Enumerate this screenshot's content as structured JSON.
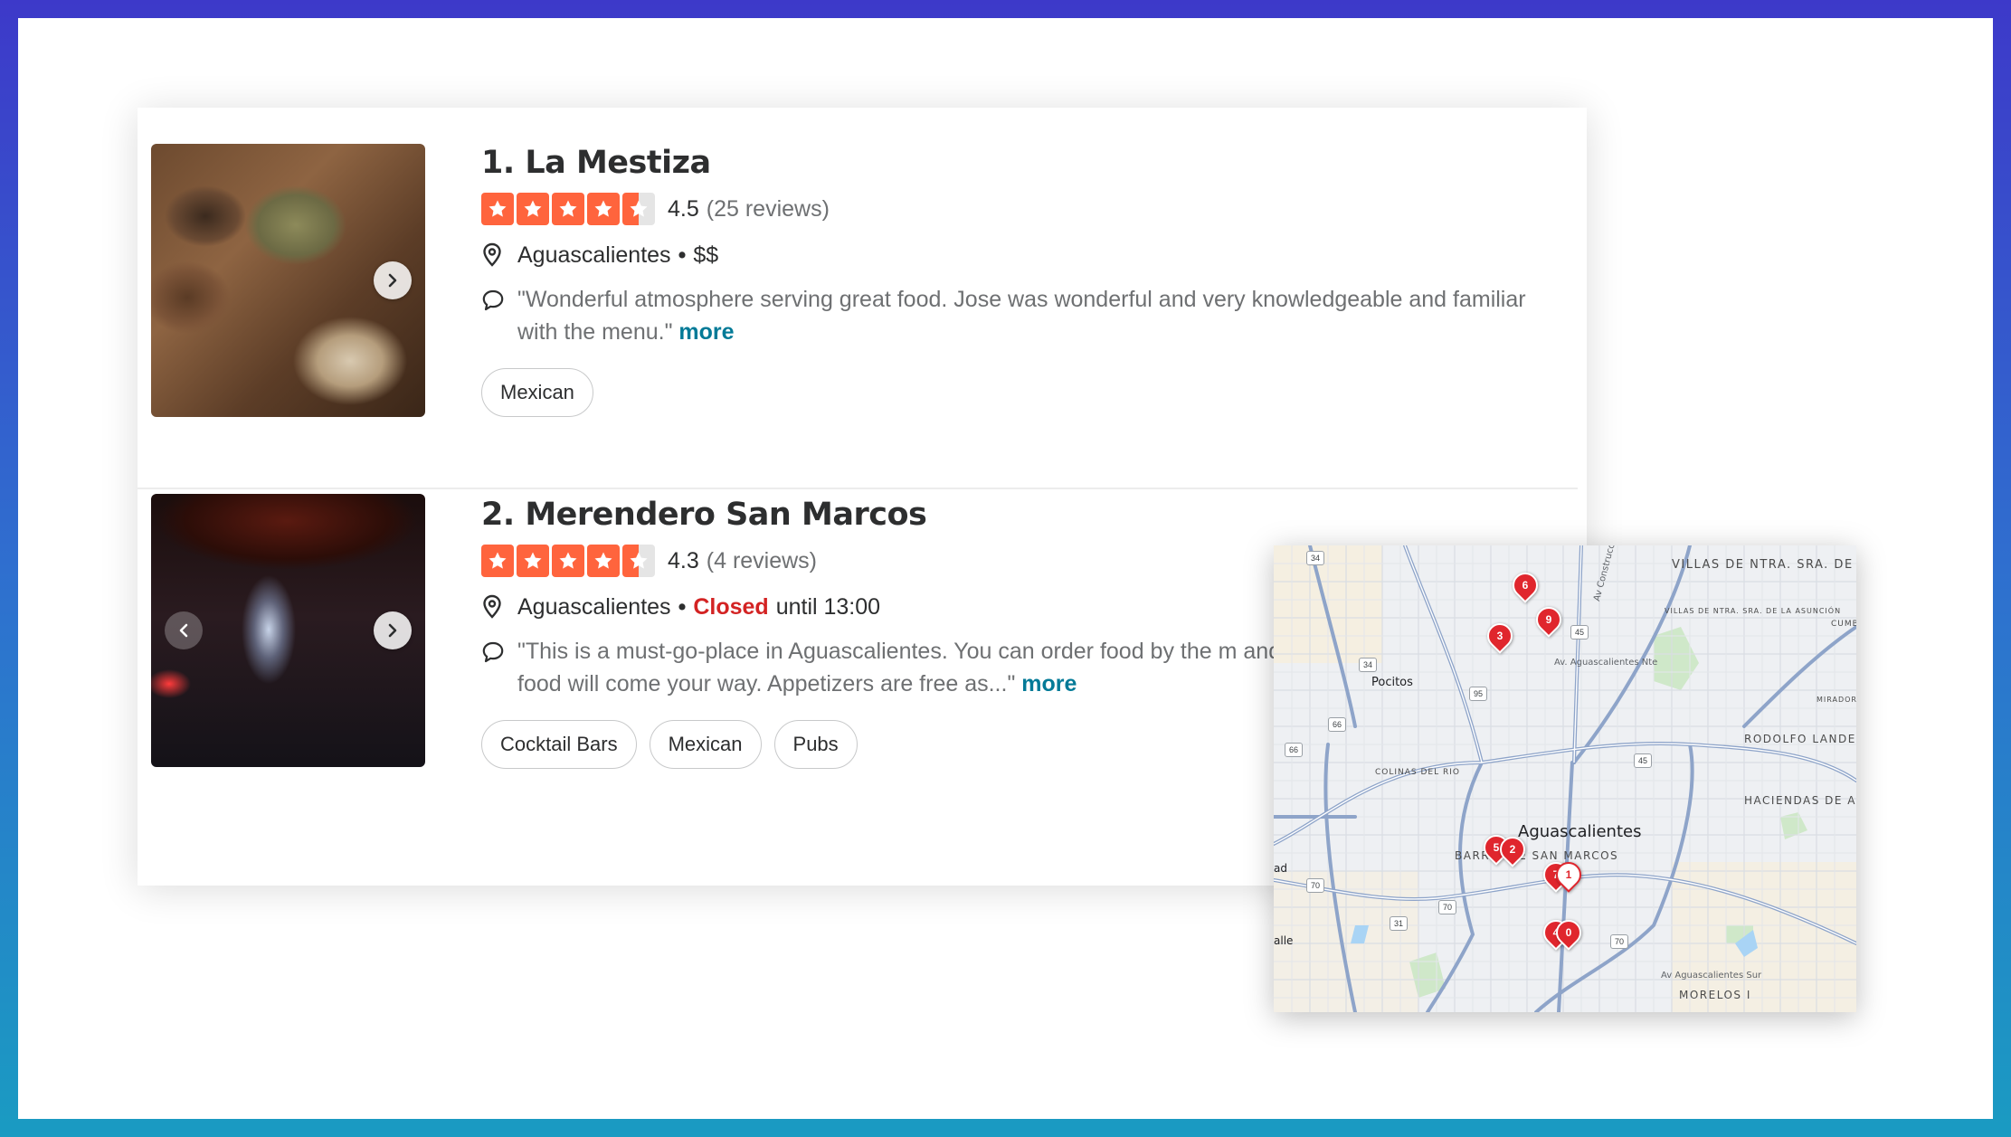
{
  "listings": [
    {
      "title": "1. La Mestiza",
      "rating": "4.5",
      "stars_value": 4.5,
      "reviews": "(25 reviews)",
      "location": "Aguascalientes",
      "separator": "•",
      "price": "$$",
      "quote": "\"Wonderful atmosphere serving great food. Jose was wonderful and very knowledgeable and familiar with the menu.\"",
      "more": "more",
      "tags": [
        "Mexican"
      ]
    },
    {
      "title": "2. Merendero San Marcos",
      "rating": "4.3",
      "stars_value": 4.3,
      "reviews": "(4 reviews)",
      "location": "Aguascalientes",
      "separator": "•",
      "status": "Closed",
      "hours": "until 13:00",
      "quote": "\"This is a must-go-place in Aguascalientes. You can order food by the m and food will come your way. Appetizers are free as...\"",
      "more": "more",
      "tags": [
        "Cocktail Bars",
        "Mexican",
        "Pubs"
      ]
    }
  ],
  "map": {
    "labels": {
      "villas": "VILLAS DE NTRA. SRA. DE LA ASUNCIÓN",
      "villas_small": "VILLAS DE NTRA. SRA. DE LA ASUNCIÓN",
      "construccion": "Av Construcción",
      "av_ags_nte": "Av. Aguascalientes Nte",
      "pocitos": "Pocitos",
      "colinas": "COLINAS DEL RIO",
      "city": "Aguascalientes",
      "barrio": "BARRIO DE SAN MARCOS",
      "rodolfo": "RODOLFO LANDEROS",
      "haciendas": "HACIENDAS DE AGUASCALIENTE",
      "mirador": "MIRADOR LAS CULTUR",
      "av_ags_sur": "Av Aguascalientes Sur",
      "morelos": "MORELOS I",
      "cumb": "CUMB",
      "ad": "ad",
      "alle": "alle"
    },
    "shields": [
      "34",
      "34",
      "45",
      "95",
      "66",
      "66",
      "45",
      "70",
      "31",
      "70",
      "70"
    ],
    "markers": [
      "6",
      "9",
      "3",
      "5",
      "2",
      "7",
      "1",
      "4",
      "0"
    ]
  },
  "colors": {
    "star": "#ff643d",
    "closed": "#d32323",
    "more": "#027a97",
    "pin": "#e0262d"
  }
}
